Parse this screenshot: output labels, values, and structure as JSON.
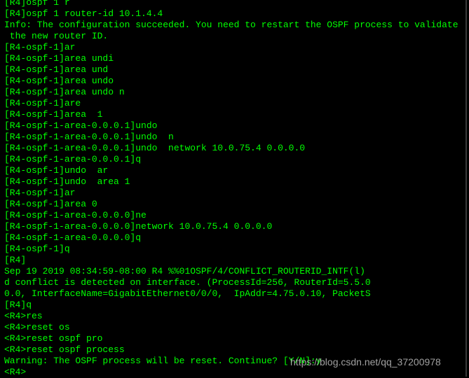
{
  "terminal": {
    "text_color": "#00ff00",
    "background": "#000000",
    "lines": [
      "[R4]ospf 1 r",
      "[R4]ospf 1 router-id 10.1.4.4",
      "Info: The configuration succeeded. You need to restart the OSPF process to validate",
      " the new router ID.",
      "[R4-ospf-1]ar",
      "[R4-ospf-1]area undi",
      "[R4-ospf-1]area und",
      "[R4-ospf-1]area undo",
      "[R4-ospf-1]area undo n",
      "[R4-ospf-1]are",
      "[R4-ospf-1]area  1",
      "[R4-ospf-1-area-0.0.0.1]undo",
      "[R4-ospf-1-area-0.0.0.1]undo  n",
      "[R4-ospf-1-area-0.0.0.1]undo  network 10.0.75.4 0.0.0.0",
      "[R4-ospf-1-area-0.0.0.1]q",
      "[R4-ospf-1]undo  ar",
      "[R4-ospf-1]undo  area 1",
      "[R4-ospf-1]ar",
      "[R4-ospf-1]area 0",
      "[R4-ospf-1-area-0.0.0.0]ne",
      "[R4-ospf-1-area-0.0.0.0]network 10.0.75.4 0.0.0.0",
      "[R4-ospf-1-area-0.0.0.0]q",
      "[R4-ospf-1]q",
      "[R4]",
      "Sep 19 2019 08:34:59-08:00 R4 %%01OSPF/4/CONFLICT_ROUTERID_INTF(l)",
      "d conflict is detected on interface. (ProcessId=256, RouterId=5.5.0",
      "0.0, InterfaceName=GigabitEthernet0/0/0,  IpAddr=4.75.0.10, PacketS",
      "[R4]q",
      "<R4>res",
      "<R4>reset os",
      "<R4>reset ospf pro",
      "<R4>reset ospf process",
      "Warning: The OSPF process will be reset. Continue? [Y/N]:y",
      "<R4>"
    ]
  },
  "watermark": "https://blog.csdn.net/qq_37200978"
}
